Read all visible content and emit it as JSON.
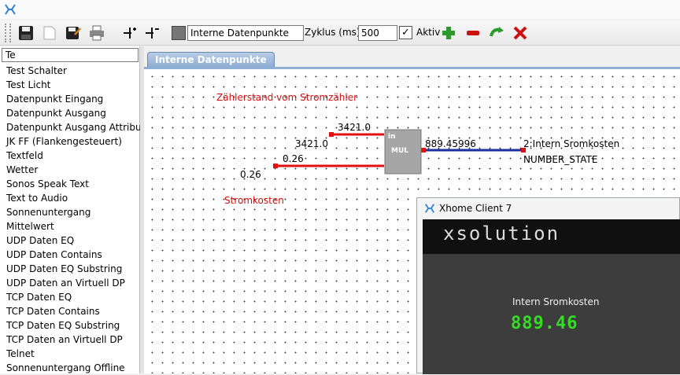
{
  "toolbar": {
    "datapoint_name": "Interne Datenpunkte",
    "cycle_label": "Zyklus (ms)",
    "cycle_value": "500",
    "active_label": "Aktiv",
    "active_checked": "✓"
  },
  "sidebar": {
    "search_value": "Te",
    "items": [
      "Test Schalter",
      "Test Licht",
      "Datenpunkt Eingang",
      "Datenpunkt Ausgang",
      "Datenpunkt Ausgang Attribute",
      "JK FF (Flankengesteuert)",
      "Textfeld",
      "Wetter",
      "Sonos Speak Text",
      "Text to Audio",
      "Sonnenuntergang",
      "Mittelwert",
      "UDP Daten EQ",
      "UDP Daten Contains",
      "UDP Daten EQ Substring",
      "UDP Daten an Virtuell DP",
      "TCP Daten EQ",
      "TCP Daten Contains",
      "TCP Daten EQ Substring",
      "TCP Daten an Virtuell DP",
      "Telnet",
      "Sonnenuntergang Offline"
    ]
  },
  "tab": {
    "label": "Interne Datenpunkte"
  },
  "canvas": {
    "comment_top": "Zählerstand vom Stromzähler",
    "comment_bottom": "Stromkosten",
    "input1_value": "3421.0",
    "input1_label": "3421.0",
    "input2_value": "0.26",
    "input2_label": "0.26",
    "block_in": "in",
    "block_name": "MUL",
    "output_value": "889.45996",
    "output_target": "2:Intern Sromkosten",
    "output_type": "NUMBER_STATE"
  },
  "client": {
    "title": "Xhome Client 7",
    "brand": "xsolution",
    "label": "Intern Sromkosten",
    "value": "889.46"
  },
  "colors": {
    "wire_red": "#e01010",
    "wire_blue": "#1a2ea0",
    "accent_tab": "#8eaed4",
    "lcd_green": "#33dd22"
  }
}
